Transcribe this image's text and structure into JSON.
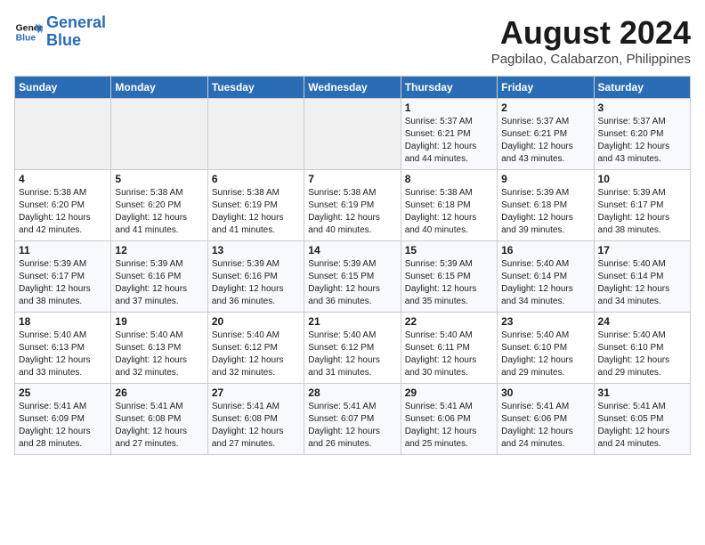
{
  "header": {
    "logo_line1": "General",
    "logo_line2": "Blue",
    "title": "August 2024",
    "subtitle": "Pagbilao, Calabarzon, Philippines"
  },
  "weekdays": [
    "Sunday",
    "Monday",
    "Tuesday",
    "Wednesday",
    "Thursday",
    "Friday",
    "Saturday"
  ],
  "weeks": [
    [
      {
        "day": "",
        "info": ""
      },
      {
        "day": "",
        "info": ""
      },
      {
        "day": "",
        "info": ""
      },
      {
        "day": "",
        "info": ""
      },
      {
        "day": "1",
        "info": "Sunrise: 5:37 AM\nSunset: 6:21 PM\nDaylight: 12 hours\nand 44 minutes."
      },
      {
        "day": "2",
        "info": "Sunrise: 5:37 AM\nSunset: 6:21 PM\nDaylight: 12 hours\nand 43 minutes."
      },
      {
        "day": "3",
        "info": "Sunrise: 5:37 AM\nSunset: 6:20 PM\nDaylight: 12 hours\nand 43 minutes."
      }
    ],
    [
      {
        "day": "4",
        "info": "Sunrise: 5:38 AM\nSunset: 6:20 PM\nDaylight: 12 hours\nand 42 minutes."
      },
      {
        "day": "5",
        "info": "Sunrise: 5:38 AM\nSunset: 6:20 PM\nDaylight: 12 hours\nand 41 minutes."
      },
      {
        "day": "6",
        "info": "Sunrise: 5:38 AM\nSunset: 6:19 PM\nDaylight: 12 hours\nand 41 minutes."
      },
      {
        "day": "7",
        "info": "Sunrise: 5:38 AM\nSunset: 6:19 PM\nDaylight: 12 hours\nand 40 minutes."
      },
      {
        "day": "8",
        "info": "Sunrise: 5:38 AM\nSunset: 6:18 PM\nDaylight: 12 hours\nand 40 minutes."
      },
      {
        "day": "9",
        "info": "Sunrise: 5:39 AM\nSunset: 6:18 PM\nDaylight: 12 hours\nand 39 minutes."
      },
      {
        "day": "10",
        "info": "Sunrise: 5:39 AM\nSunset: 6:17 PM\nDaylight: 12 hours\nand 38 minutes."
      }
    ],
    [
      {
        "day": "11",
        "info": "Sunrise: 5:39 AM\nSunset: 6:17 PM\nDaylight: 12 hours\nand 38 minutes."
      },
      {
        "day": "12",
        "info": "Sunrise: 5:39 AM\nSunset: 6:16 PM\nDaylight: 12 hours\nand 37 minutes."
      },
      {
        "day": "13",
        "info": "Sunrise: 5:39 AM\nSunset: 6:16 PM\nDaylight: 12 hours\nand 36 minutes."
      },
      {
        "day": "14",
        "info": "Sunrise: 5:39 AM\nSunset: 6:15 PM\nDaylight: 12 hours\nand 36 minutes."
      },
      {
        "day": "15",
        "info": "Sunrise: 5:39 AM\nSunset: 6:15 PM\nDaylight: 12 hours\nand 35 minutes."
      },
      {
        "day": "16",
        "info": "Sunrise: 5:40 AM\nSunset: 6:14 PM\nDaylight: 12 hours\nand 34 minutes."
      },
      {
        "day": "17",
        "info": "Sunrise: 5:40 AM\nSunset: 6:14 PM\nDaylight: 12 hours\nand 34 minutes."
      }
    ],
    [
      {
        "day": "18",
        "info": "Sunrise: 5:40 AM\nSunset: 6:13 PM\nDaylight: 12 hours\nand 33 minutes."
      },
      {
        "day": "19",
        "info": "Sunrise: 5:40 AM\nSunset: 6:13 PM\nDaylight: 12 hours\nand 32 minutes."
      },
      {
        "day": "20",
        "info": "Sunrise: 5:40 AM\nSunset: 6:12 PM\nDaylight: 12 hours\nand 32 minutes."
      },
      {
        "day": "21",
        "info": "Sunrise: 5:40 AM\nSunset: 6:12 PM\nDaylight: 12 hours\nand 31 minutes."
      },
      {
        "day": "22",
        "info": "Sunrise: 5:40 AM\nSunset: 6:11 PM\nDaylight: 12 hours\nand 30 minutes."
      },
      {
        "day": "23",
        "info": "Sunrise: 5:40 AM\nSunset: 6:10 PM\nDaylight: 12 hours\nand 29 minutes."
      },
      {
        "day": "24",
        "info": "Sunrise: 5:40 AM\nSunset: 6:10 PM\nDaylight: 12 hours\nand 29 minutes."
      }
    ],
    [
      {
        "day": "25",
        "info": "Sunrise: 5:41 AM\nSunset: 6:09 PM\nDaylight: 12 hours\nand 28 minutes."
      },
      {
        "day": "26",
        "info": "Sunrise: 5:41 AM\nSunset: 6:08 PM\nDaylight: 12 hours\nand 27 minutes."
      },
      {
        "day": "27",
        "info": "Sunrise: 5:41 AM\nSunset: 6:08 PM\nDaylight: 12 hours\nand 27 minutes."
      },
      {
        "day": "28",
        "info": "Sunrise: 5:41 AM\nSunset: 6:07 PM\nDaylight: 12 hours\nand 26 minutes."
      },
      {
        "day": "29",
        "info": "Sunrise: 5:41 AM\nSunset: 6:06 PM\nDaylight: 12 hours\nand 25 minutes."
      },
      {
        "day": "30",
        "info": "Sunrise: 5:41 AM\nSunset: 6:06 PM\nDaylight: 12 hours\nand 24 minutes."
      },
      {
        "day": "31",
        "info": "Sunrise: 5:41 AM\nSunset: 6:05 PM\nDaylight: 12 hours\nand 24 minutes."
      }
    ]
  ]
}
